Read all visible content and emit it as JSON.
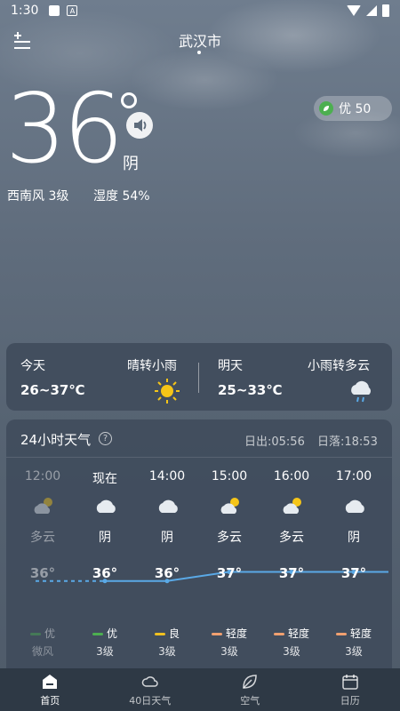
{
  "status": {
    "time": "1:30",
    "a_glyph": "A"
  },
  "header": {
    "city": "武汉市"
  },
  "current": {
    "temperature": "36",
    "condition": "阴",
    "aqi_label": "优 50",
    "wind": "西南风 3级",
    "humidity": "湿度 54%"
  },
  "forecast": {
    "today": {
      "day": "今天",
      "range": "26~37℃",
      "condition": "晴转小雨",
      "icon": "sun-icon"
    },
    "tomorrow": {
      "day": "明天",
      "range": "25~33℃",
      "condition": "小雨转多云",
      "icon": "cloud-rain-icon"
    }
  },
  "hourly": {
    "title": "24小时天气",
    "help_glyph": "?",
    "sunrise": "日出:05:56",
    "sunset": "日落:18:53",
    "items": [
      {
        "time": "12:00",
        "condition": "多云",
        "temp": "36°",
        "temp_value": 36,
        "aqi": "优",
        "aqi_color": "#4caf50",
        "wind": "微风",
        "icon": "partly-cloudy-icon",
        "past": true
      },
      {
        "time": "现在",
        "condition": "阴",
        "temp": "36°",
        "temp_value": 36,
        "aqi": "优",
        "aqi_color": "#4caf50",
        "wind": "3级",
        "icon": "cloud-icon",
        "past": false
      },
      {
        "time": "14:00",
        "condition": "阴",
        "temp": "36°",
        "temp_value": 36,
        "aqi": "良",
        "aqi_color": "#f0c020",
        "wind": "3级",
        "icon": "cloud-icon",
        "past": false
      },
      {
        "time": "15:00",
        "condition": "多云",
        "temp": "37°",
        "temp_value": 37,
        "aqi": "轻度",
        "aqi_color": "#f0a070",
        "wind": "3级",
        "icon": "partly-cloudy-icon",
        "past": false
      },
      {
        "time": "16:00",
        "condition": "多云",
        "temp": "37°",
        "temp_value": 37,
        "aqi": "轻度",
        "aqi_color": "#f0a070",
        "wind": "3级",
        "icon": "partly-cloudy-icon",
        "past": false
      },
      {
        "time": "17:00",
        "condition": "阴",
        "temp": "37°",
        "temp_value": 37,
        "aqi": "轻度",
        "aqi_color": "#f0a070",
        "wind": "3级",
        "icon": "cloud-icon",
        "past": false
      }
    ]
  },
  "nav": [
    {
      "label": "首页",
      "icon": "home-icon",
      "active": true
    },
    {
      "label": "40日天气",
      "icon": "cloud-outline-icon",
      "active": false
    },
    {
      "label": "空气",
      "icon": "leaf-icon",
      "active": false
    },
    {
      "label": "日历",
      "icon": "calendar-icon",
      "active": false
    }
  ],
  "colors": {
    "line": "#5aa9e6",
    "card_bg": "#404c5c",
    "nav_bg": "#2e3945"
  }
}
